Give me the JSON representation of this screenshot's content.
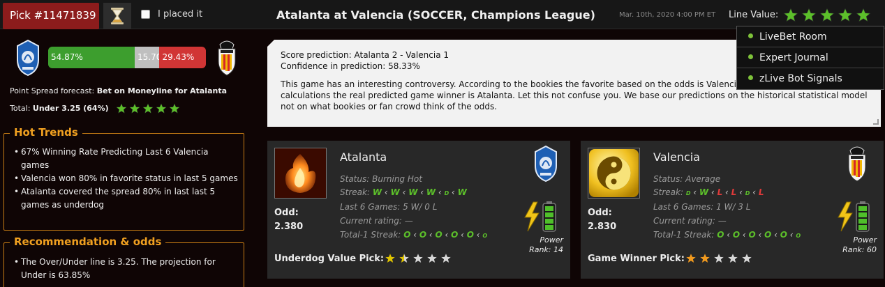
{
  "header": {
    "pick_id": "Pick #11471839",
    "placed_label": "I placed it",
    "title": "Atalanta at Valencia (SOCCER, Champions League)",
    "date": "Mar. 10th, 2020 4:00 PM ET",
    "line_value_label": "Line Value:",
    "line_value_stars": 5,
    "star_color": "#5cbf2a"
  },
  "menu": {
    "items": [
      "LiveBet Room",
      "Expert Journal",
      "zLive Bot Signals"
    ]
  },
  "probability_bar": {
    "home": "54.87%",
    "draw": "15.70%",
    "away": "29.43%",
    "home_fraction": 0.5487,
    "draw_fraction": 0.157,
    "away_fraction": 0.2943,
    "home_color": "#3d9e2e",
    "draw_color": "#bfbfbf",
    "away_color": "#d13535"
  },
  "point_spread": {
    "label": "Point Spread forecast:",
    "value": "Bet on Moneyline for Atalanta"
  },
  "total": {
    "label": "Total:",
    "value": "Under 3.25 (64%)",
    "stars": 5
  },
  "hot_trends": {
    "title": "Hot Trends",
    "items": [
      "67% Winning Rate Predicting Last 6 Valencia games",
      "Valencia won 80% in favorite status in last 5 games",
      "Atalanta covered the spread 80% in last last 5 games as underdog"
    ]
  },
  "recommendation": {
    "title": "Recommendation & odds",
    "items": [
      "The Over/Under line is 3.25. The projection for Under is 63.85%"
    ]
  },
  "prediction": {
    "score": "Score prediction: Atalanta 2 - Valencia 1",
    "confidence": "Confidence in prediction: 58.33%",
    "body": "This game has an interesting controversy. According to the bookies the favorite based on the odds is Valencia however based on ZCode calculations the real predicted game winner is Atalanta. Let this not confuse you. We base our predictions on the historical statistical model not on what bookies or fan crowd think of the odds."
  },
  "teams": [
    {
      "name": "Atalanta",
      "status_label": "Status:",
      "status": "Burning Hot",
      "streak_label": "Streak:",
      "streak": [
        "W",
        "W",
        "W",
        "W",
        "D",
        "W"
      ],
      "last6_label": "Last 6 Games:",
      "last6": "5 W/ 0 L",
      "rating_label": "Current rating:",
      "rating": "—",
      "total1_label": "Total-1 Streak:",
      "total1": [
        "O",
        "O",
        "O",
        "O",
        "O",
        "O"
      ],
      "odd_label": "Odd:",
      "odd": "2.380",
      "power_label": "Power",
      "power_rank": "Rank: 14",
      "pick_label": "Underdog Value Pick:",
      "pick_stars": 1.5,
      "icon": "fire-icon",
      "logo": "atalanta-logo"
    },
    {
      "name": "Valencia",
      "status_label": "Status:",
      "status": "Average",
      "streak_label": "Streak:",
      "streak": [
        "D",
        "W",
        "L",
        "L",
        "D",
        "L"
      ],
      "last6_label": "Last 6 Games:",
      "last6": "1 W/ 3 L",
      "rating_label": "Current rating:",
      "rating": "—",
      "total1_label": "Total-1 Streak:",
      "total1": [
        "O",
        "O",
        "O",
        "O",
        "O",
        "O"
      ],
      "odd_label": "Odd:",
      "odd": "2.830",
      "power_label": "Power",
      "power_rank": "Rank: 60",
      "pick_label": "Game Winner Pick:",
      "pick_stars": 2,
      "icon": "yin-yang-icon",
      "logo": "valencia-logo"
    }
  ]
}
